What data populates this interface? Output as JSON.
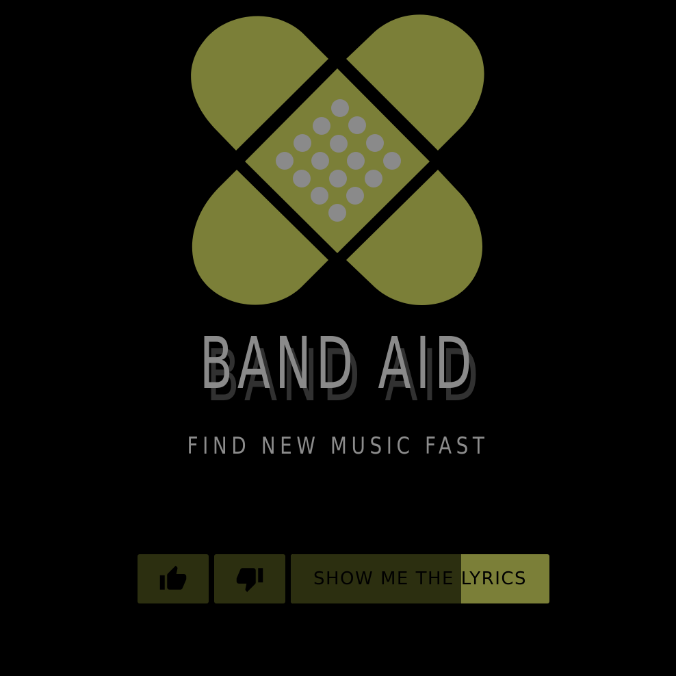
{
  "brand": {
    "title": "BAND AID",
    "tagline": "FIND NEW MUSIC FAST"
  },
  "colors": {
    "background": "#000000",
    "accent": "#7b7f38",
    "accent_dark": "#2c2f10",
    "text_gray": "#8a8a8a",
    "dots": "#8a8a8a"
  },
  "controls": {
    "like_icon": "thumbs-up-icon",
    "dislike_icon": "thumbs-down-icon",
    "lyrics_label": "SHOW ME THE LYRICS"
  }
}
